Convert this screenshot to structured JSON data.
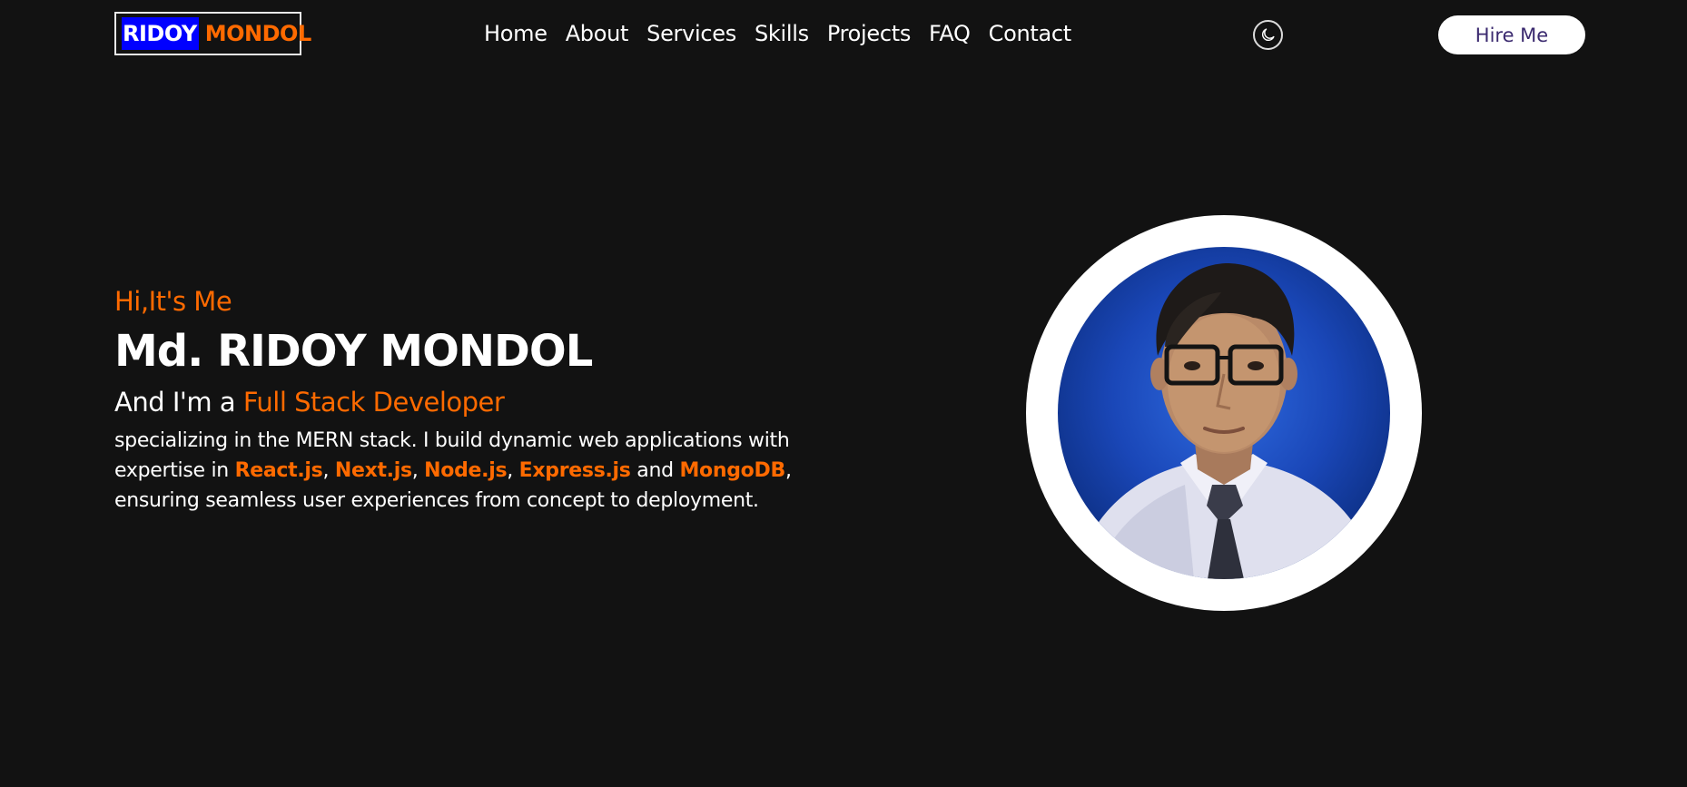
{
  "logo": {
    "part1": "RIDOY",
    "part2": "MONDOL"
  },
  "nav": {
    "items": [
      {
        "label": "Home"
      },
      {
        "label": "About"
      },
      {
        "label": "Services"
      },
      {
        "label": "Skills"
      },
      {
        "label": "Projects"
      },
      {
        "label": "FAQ"
      },
      {
        "label": "Contact"
      }
    ],
    "theme_icon": "moon-icon",
    "hire_label": "Hire Me"
  },
  "hero": {
    "greeting": "Hi,It's Me",
    "name": "Md. RIDOY MONDOL",
    "role_prefix": "And I'm a ",
    "role_accent": "Full Stack Developer",
    "desc_part1": "specializing in the MERN stack. I build dynamic web applications with expertise in ",
    "tech": [
      "React.js",
      "Next.js",
      "Node.js",
      "Express.js",
      "MongoDB"
    ],
    "sep1": ", ",
    "sep2": ", ",
    "sep3": ", ",
    "sep4": " and ",
    "desc_part2": ", ensuring seamless user experiences from concept to deployment."
  },
  "colors": {
    "background": "#121212",
    "accent": "#ff6a00",
    "logo_highlight": "#0000ff"
  }
}
